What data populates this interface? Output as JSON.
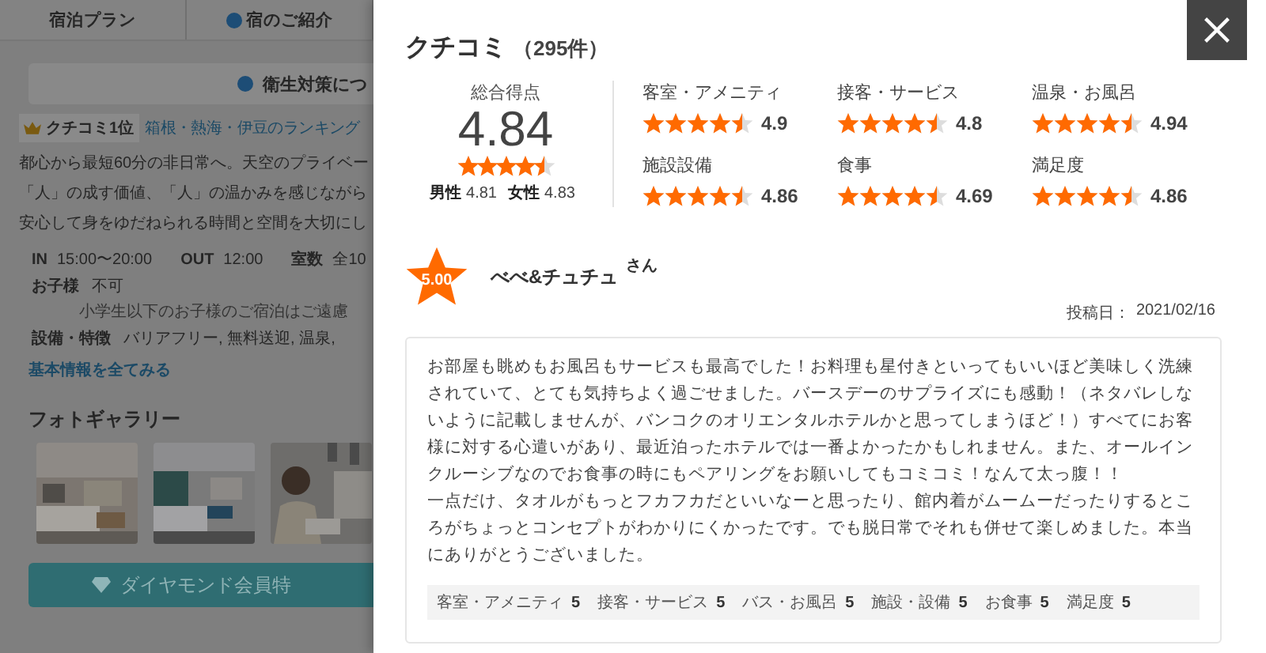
{
  "background_page": {
    "tabs": [
      {
        "label": "宿泊プラン",
        "kind": "plain"
      },
      {
        "label": "宿のご紹介",
        "kind": "info"
      }
    ],
    "notice": "衛生対策につ",
    "badge": "クチコミ1位",
    "ranking_link": "箱根・熱海・伊豆のランキング",
    "description_lines": [
      "都心から最短60分の非日常へ。天空のプライベー",
      "「人」の成す価値、「人」の温かみを感じながら",
      "安心して身をゆだねられる時間と空間を大切にし"
    ],
    "facts": [
      {
        "label": "IN",
        "value": "15:00〜20:00"
      },
      {
        "label": "OUT",
        "value": "12:00"
      },
      {
        "label": "室数",
        "value": "全10"
      }
    ],
    "children": {
      "label": "お子様",
      "value": "不可",
      "note": "小学生以下のお子様のご宿泊はご遠慮"
    },
    "features": {
      "label": "設備・特徴",
      "value": "バリアフリー, 無料送迎, 温泉,"
    },
    "more_link": "基本情報を全てみる",
    "gallery_title": "フォトギャラリー",
    "member_button": "ダイヤモンド会員特"
  },
  "reviews_panel": {
    "title": "クチコミ",
    "count": "（295件）",
    "overall": {
      "label": "総合得点",
      "score": "4.84",
      "stars": 4.5,
      "male_label": "男性",
      "male": "4.81",
      "female_label": "女性",
      "female": "4.83"
    },
    "categories": [
      {
        "label": "客室・アメニティ",
        "stars": 4.5,
        "score": "4.9"
      },
      {
        "label": "接客・サービス",
        "stars": 4.5,
        "score": "4.8"
      },
      {
        "label": "温泉・お風呂",
        "stars": 4.5,
        "score": "4.94"
      },
      {
        "label": "施設設備",
        "stars": 4.5,
        "score": "4.86"
      },
      {
        "label": "食事",
        "stars": 4.5,
        "score": "4.69"
      },
      {
        "label": "満足度",
        "stars": 4.5,
        "score": "4.86"
      }
    ],
    "review": {
      "score": "5.00",
      "name": "べべ&チュチュ",
      "honorific": "さん",
      "date_label": "投稿日：",
      "date": "2021/02/16",
      "paragraphs": [
        "お部屋も眺めもお風呂もサービスも最高でした！お料理も星付きといってもいいほど美味しく洗練されていて、とても気持ちよく過ごせました。バースデーのサプライズにも感動！（ネタバレしないように記載しませんが、バンコクのオリエンタルホテルかと思ってしまうほど！）すべてにお客様に対する心遣いがあり、最近泊ったホテルでは一番よかったかもしれません。また、オールインクルーシブなのでお食事の時にもペアリングをお願いしてもコミコミ！なんて太っ腹！！",
        "一点だけ、タオルがもっとフカフカだといいなーと思ったり、館内着がムームーだったりするところがちょっとコンセプトがわかりにくかったです。でも脱日常でそれも併せて楽しめました。本当にありがとうございました。"
      ],
      "ratings": [
        {
          "label": "客室・アメニティ",
          "value": "5"
        },
        {
          "label": "接客・サービス",
          "value": "5"
        },
        {
          "label": "バス・お風呂",
          "value": "5"
        },
        {
          "label": "施設・設備",
          "value": "5"
        },
        {
          "label": "お食事",
          "value": "5"
        },
        {
          "label": "満足度",
          "value": "5"
        }
      ]
    }
  }
}
